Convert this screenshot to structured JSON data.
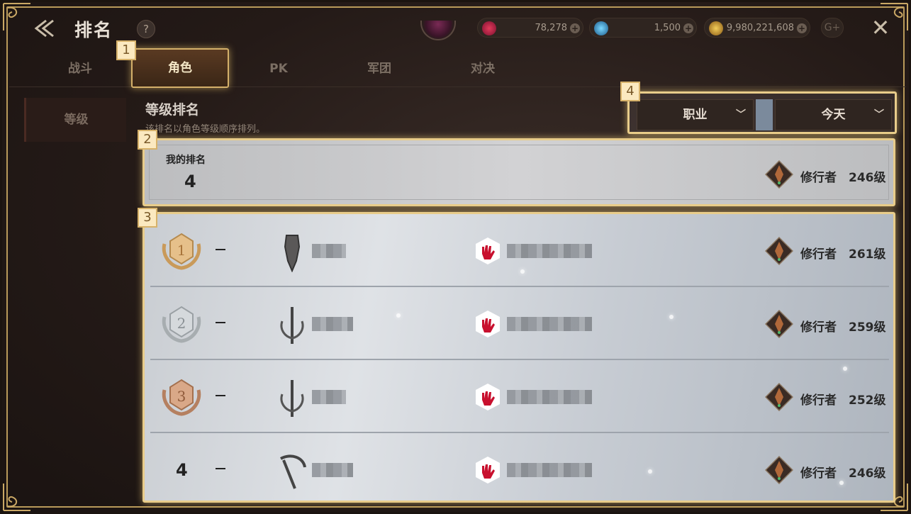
{
  "header": {
    "title": "排名",
    "help_label": "?",
    "currencies": [
      {
        "name": "ruby",
        "value": "78,278",
        "add_label": "+"
      },
      {
        "name": "diamond",
        "value": "1,500",
        "add_label": "+"
      },
      {
        "name": "gold",
        "value": "9,980,221,608",
        "add_label": "+"
      }
    ],
    "g_label": "G+",
    "close_label": "✕"
  },
  "tabs": [
    {
      "label": "战斗"
    },
    {
      "label": "角色"
    },
    {
      "label": "PK"
    },
    {
      "label": "军团"
    },
    {
      "label": "对决"
    }
  ],
  "active_tab": 1,
  "sidebar": {
    "items": [
      {
        "label": "等级"
      }
    ]
  },
  "section": {
    "title": "等级排名",
    "description": "该排名以角色等级顺序排列。"
  },
  "filters": {
    "job_label": "职业",
    "time_label": "今天"
  },
  "my_rank": {
    "label": "我的排名",
    "value": "4",
    "class_name": "修行者",
    "level": "246级"
  },
  "rankings": [
    {
      "rank": "1",
      "class_name": "修行者",
      "level": "261级",
      "trend": "–"
    },
    {
      "rank": "2",
      "class_name": "修行者",
      "level": "259级",
      "trend": "–"
    },
    {
      "rank": "3",
      "class_name": "修行者",
      "level": "252级",
      "trend": "–"
    },
    {
      "rank": "4",
      "class_name": "修行者",
      "level": "246级",
      "trend": "–"
    }
  ],
  "callouts": [
    "1",
    "2",
    "3",
    "4"
  ],
  "colors": {
    "gold_highlight": "#e8cc8a",
    "accent_red": "#c8102e"
  }
}
